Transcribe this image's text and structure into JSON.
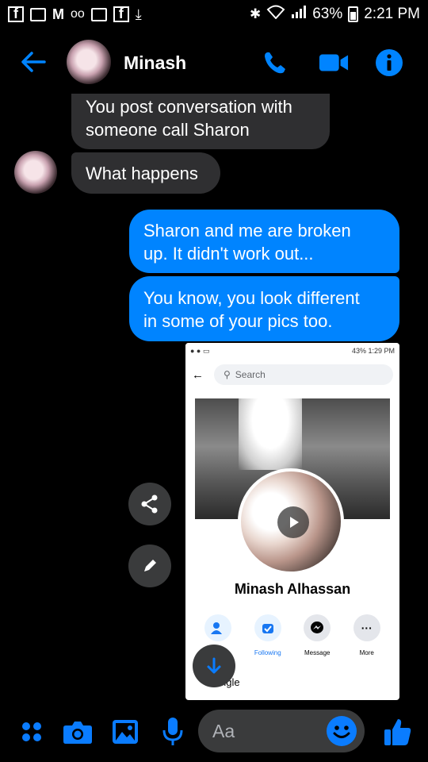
{
  "status_bar": {
    "battery": "63%",
    "time": "2:21 PM"
  },
  "header": {
    "contact_name": "Minash"
  },
  "messages": [
    {
      "from": "them",
      "lines": [
        "You post conversation with",
        "someone call Sharon"
      ]
    },
    {
      "from": "them",
      "lines": [
        "What happens"
      ]
    },
    {
      "from": "me",
      "lines": [
        "Sharon and me are broken",
        "up. It didn't work out..."
      ]
    },
    {
      "from": "me",
      "lines": [
        "You know, you look different",
        "in some of your pics too."
      ]
    }
  ],
  "shared_image": {
    "status_battery": "43%",
    "status_time": "1:29 PM",
    "search_placeholder": "Search",
    "profile_name": "Minash Alhassan",
    "actions": [
      "",
      "Following",
      "Message",
      "More"
    ],
    "partial_text": "ngle"
  },
  "composer": {
    "placeholder": "Aa"
  },
  "colors": {
    "accent": "#0084ff",
    "incoming_bubble": "#2f2f31",
    "background": "#000000"
  }
}
